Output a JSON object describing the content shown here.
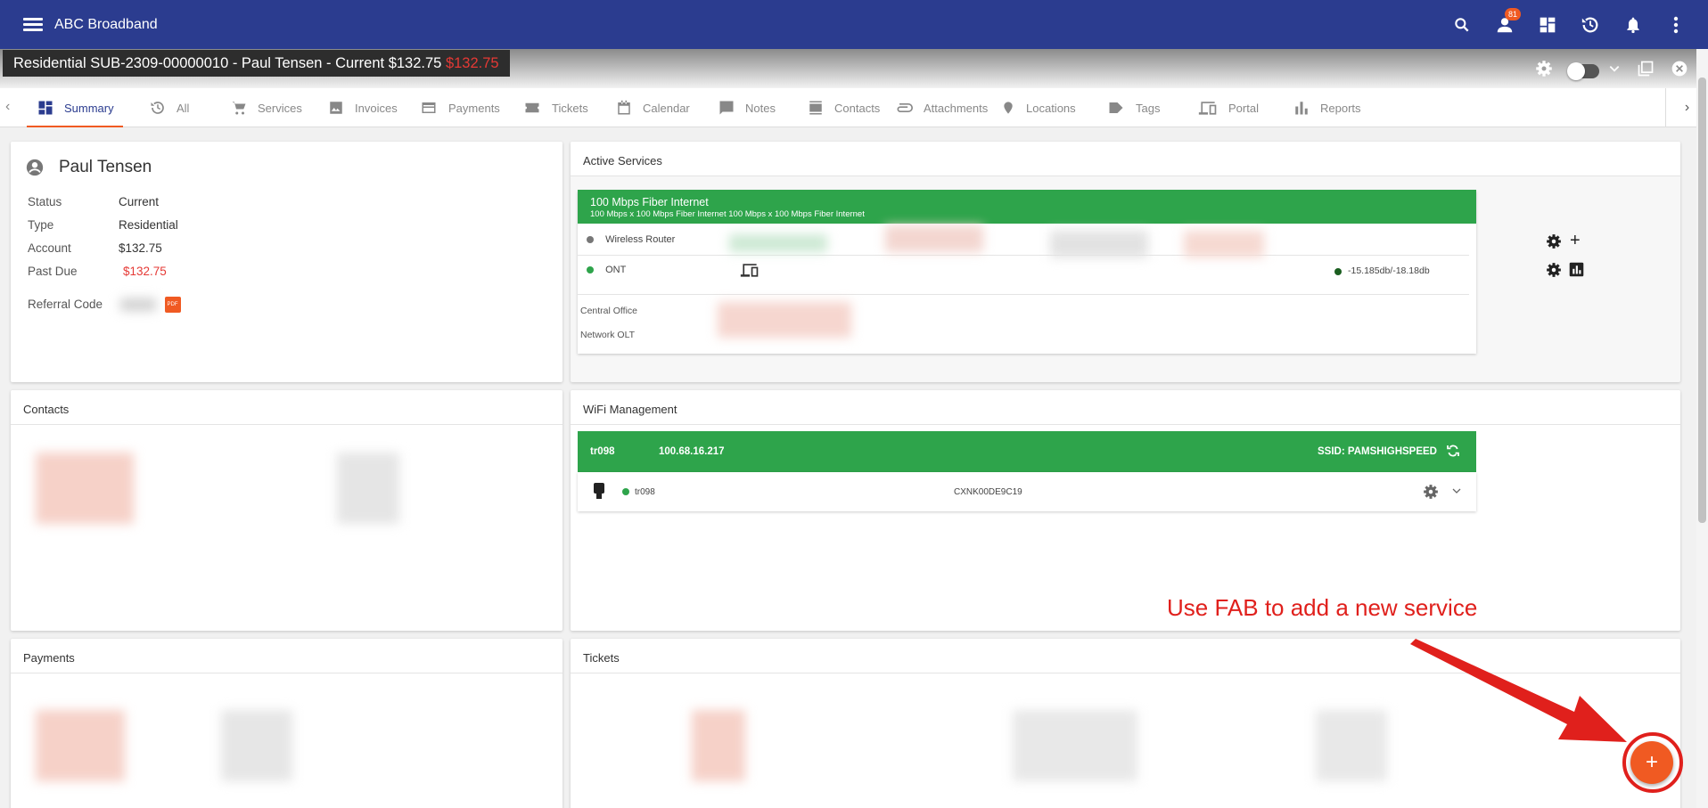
{
  "app": {
    "title": "ABC Broadband",
    "notifications_badge": "81"
  },
  "subscriber": {
    "title": "Residential  SUB-2309-00000010 - Paul Tensen - Current $132.75",
    "due": "$132.75"
  },
  "tabs": [
    {
      "label": "Summary",
      "icon": "dashboard-icon"
    },
    {
      "label": "All",
      "icon": "history-icon"
    },
    {
      "label": "Services",
      "icon": "cart-icon"
    },
    {
      "label": "Invoices",
      "icon": "image-icon"
    },
    {
      "label": "Payments",
      "icon": "credit-card-icon"
    },
    {
      "label": "Tickets",
      "icon": "ticket-icon"
    },
    {
      "label": "Calendar",
      "icon": "calendar-icon"
    },
    {
      "label": "Notes",
      "icon": "comment-icon"
    },
    {
      "label": "Contacts",
      "icon": "contacts-icon"
    },
    {
      "label": "Attachments",
      "icon": "paperclip-icon"
    },
    {
      "label": "Locations",
      "icon": "location-pin-icon"
    },
    {
      "label": "Tags",
      "icon": "tag-icon"
    },
    {
      "label": "Portal",
      "icon": "devices-icon"
    },
    {
      "label": "Reports",
      "icon": "bar-chart-icon"
    }
  ],
  "profile": {
    "name": "Paul Tensen",
    "fields": [
      {
        "label": "Status",
        "value": "Current"
      },
      {
        "label": "Type",
        "value": "Residential"
      },
      {
        "label": "Account",
        "value": "$132.75"
      },
      {
        "label": "Past Due",
        "value": "$132.75"
      }
    ],
    "referral_label": "Referral Code",
    "pdf_label": "PDF"
  },
  "active_services": {
    "title": "Active Services",
    "service_name": "100 Mbps Fiber Internet",
    "service_desc": "100 Mbps x 100 Mbps Fiber Internet 100 Mbps x 100 Mbps Fiber Internet",
    "device1": "Wireless Router",
    "device2": "ONT",
    "signal": "-15.185db/-18.18db",
    "central_office": "Central Office",
    "network_olt": "Network OLT"
  },
  "wifi": {
    "title": "WiFi Management",
    "name": "tr098",
    "ip": "100.68.16.217",
    "ssid": "SSID: PAMSHIGHSPEED",
    "device_name": "tr098",
    "serial": "CXNK00DE9C19"
  },
  "sections": {
    "contacts": "Contacts",
    "payments": "Payments",
    "tickets": "Tickets"
  },
  "annotation": "Use FAB to add a new service",
  "fab_label": "+",
  "colors": {
    "primary": "#2b3c8f",
    "accent": "#f05a22",
    "success": "#2ea44b",
    "danger": "#e53935"
  }
}
